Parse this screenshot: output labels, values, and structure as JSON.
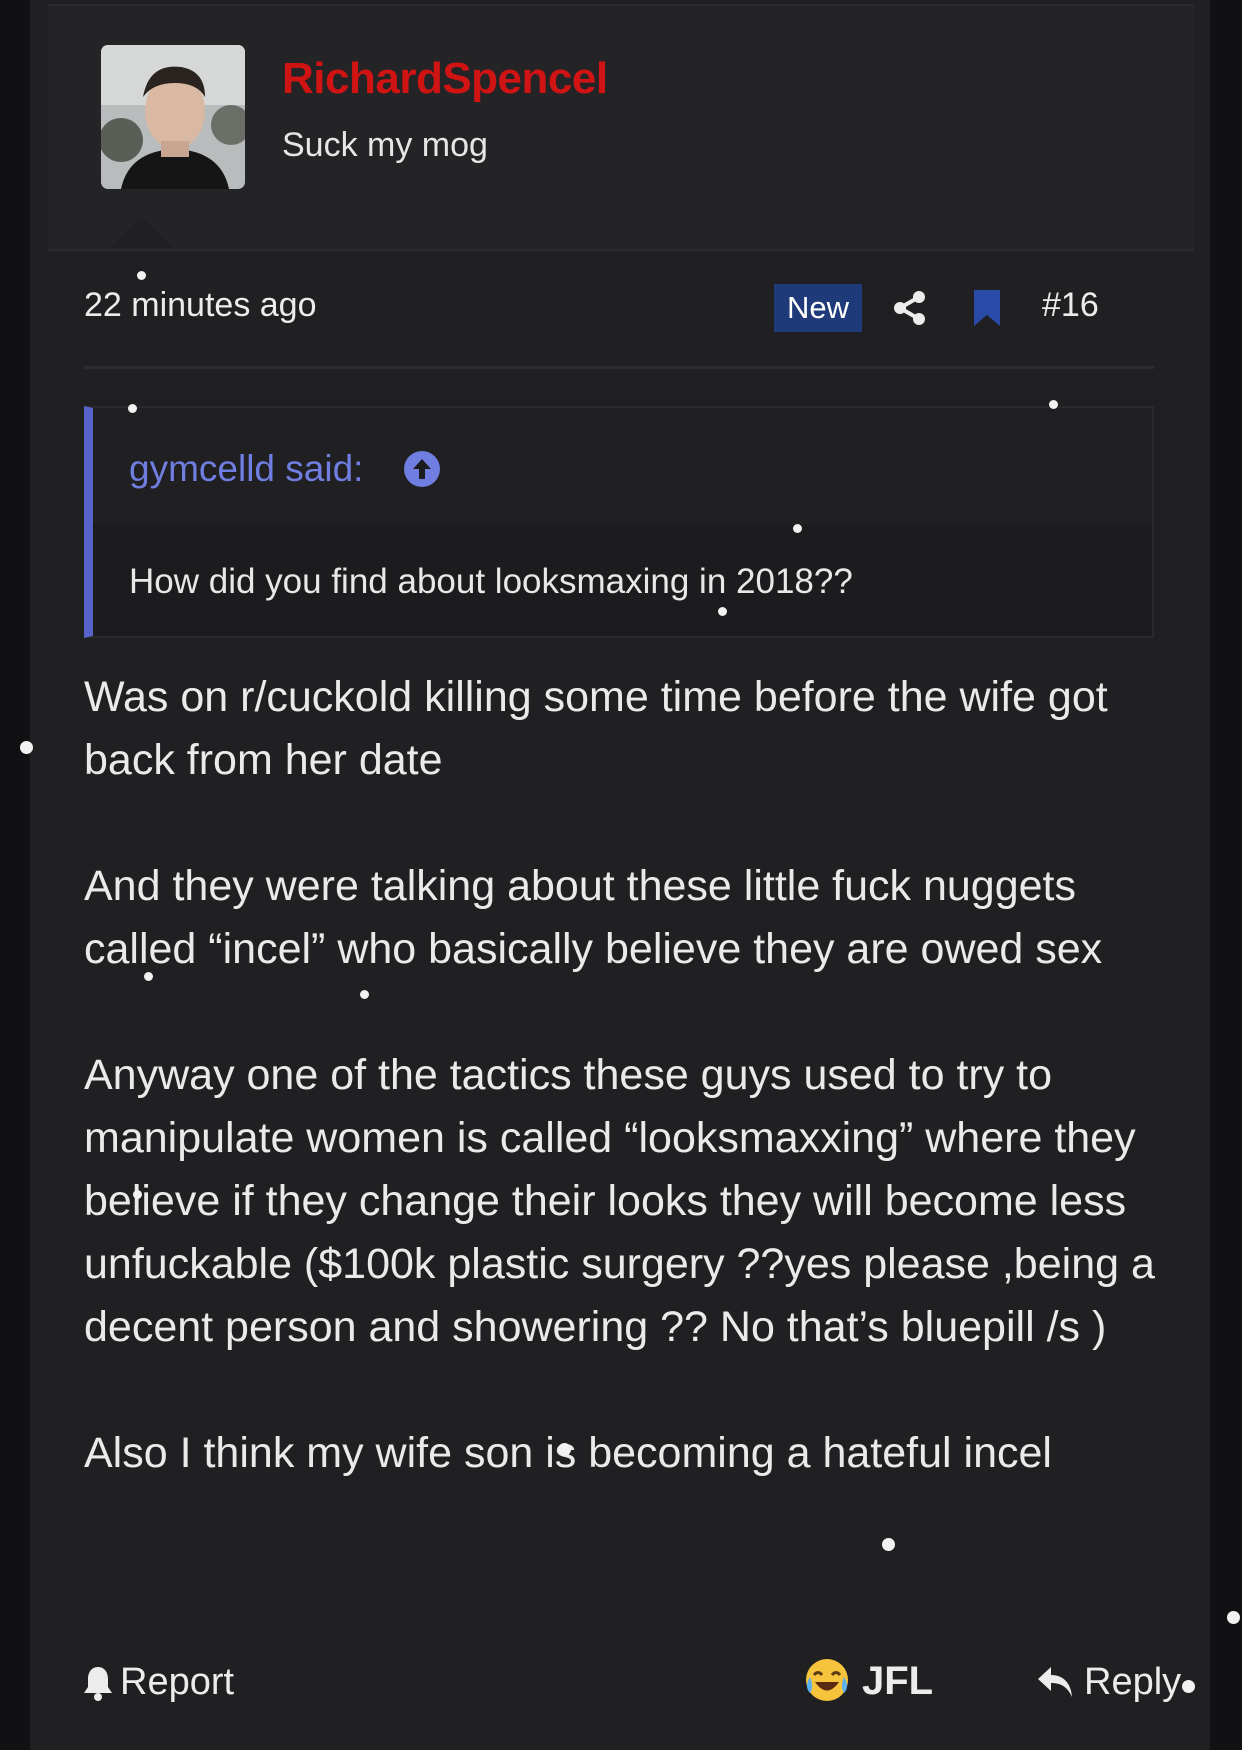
{
  "post": {
    "author": {
      "username": "RichardSpencel",
      "title": "Suck my mog",
      "username_color": "#d01414"
    },
    "meta": {
      "time": "22 minutes ago",
      "new_badge": "New",
      "post_number": "#16",
      "badge_color": "#1f3a78"
    },
    "quote": {
      "author_label": "gymcelld said:",
      "text": "How did you find about looksmaxing in 2018??",
      "accent_color": "#5763c8"
    },
    "body": {
      "p1": "Was on r/cuckold killing some time before the wife got back from her date",
      "p2": "And they were talking about these little fuck nuggets called “incel” who basically believe they are owed sex",
      "p3": "Anyway one of the tactics these guys used to try to manipulate women is called “looksmaxxing” where they believe if they change their looks they will become less unfuckable ($100k plastic surgery ??yes please ,being a decent person and showering ?? No that’s bluepill /s )",
      "p4": "Also I think my wife son is becoming a hateful incel"
    },
    "actions": {
      "report": "Report",
      "jfl": "JFL",
      "reply": "Reply"
    },
    "icons": [
      "share-icon",
      "bookmark-icon",
      "arrow-up-circle-icon",
      "bell-icon",
      "crying-laughing-emoji-icon",
      "reply-arrow-icon"
    ]
  }
}
